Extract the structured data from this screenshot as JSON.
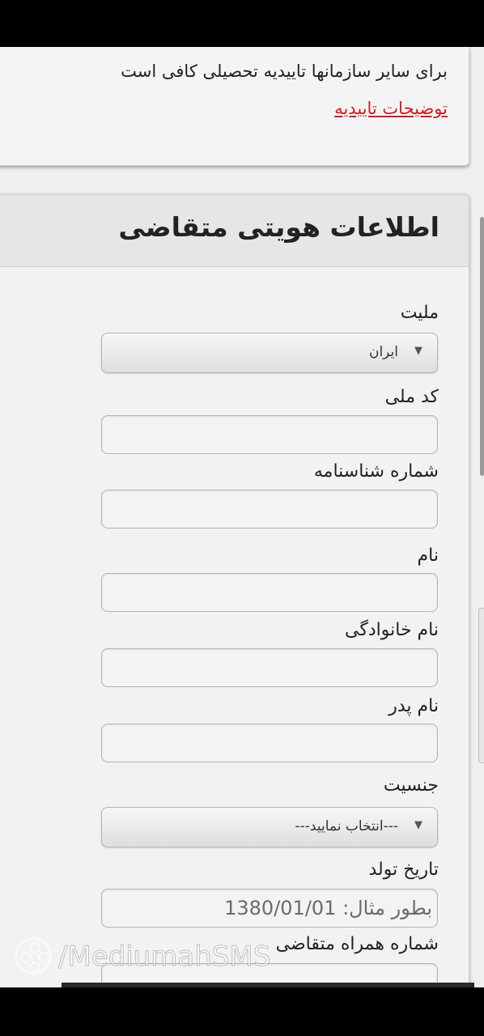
{
  "top_card": {
    "info_text": "برای سایر سازمانها تاییدیه تحصیلی کافی است",
    "link_text": "توضیحات تاییدیه"
  },
  "form": {
    "title": "اطلاعات هویتی متقاضی",
    "nationality": {
      "label": "ملیت",
      "selected": "ایران"
    },
    "national_code": {
      "label": "کد ملی",
      "value": ""
    },
    "id_number": {
      "label": "شماره شناسنامه",
      "value": ""
    },
    "first_name": {
      "label": "نام",
      "value": ""
    },
    "last_name": {
      "label": "نام خانوادگی",
      "value": ""
    },
    "father_name": {
      "label": "نام پدر",
      "value": ""
    },
    "gender": {
      "label": "جنسیت",
      "selected": "---انتخاب نمایید---"
    },
    "birth_date": {
      "label": "تاریخ تولد",
      "placeholder": "بطور مثال: 1380/01/01"
    },
    "mobile": {
      "label": "شماره همراه متقاضی"
    }
  },
  "watermark": {
    "text": "/MediumahSMS"
  },
  "icons": {
    "dropdown": "triangle-down-icon",
    "logo": "film-reel-icon"
  }
}
